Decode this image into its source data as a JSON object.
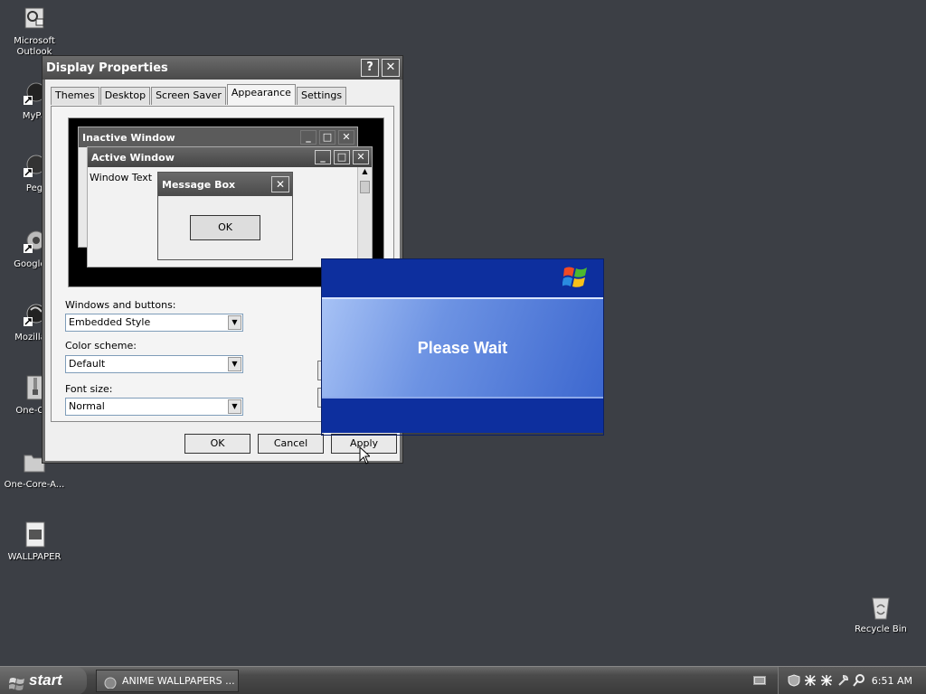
{
  "desktop": {
    "icons": [
      {
        "label": "Microsoft Outlook"
      },
      {
        "label": "MyPa"
      },
      {
        "label": "Peg"
      },
      {
        "label": "Google C"
      },
      {
        "label": "Mozilla F"
      },
      {
        "label": "One-Cor"
      },
      {
        "label": "One-Core-A..."
      },
      {
        "label": "WALLPAPER"
      },
      {
        "label": "Recycle Bin"
      }
    ]
  },
  "dialog": {
    "title": "Display Properties",
    "tabs": [
      "Themes",
      "Desktop",
      "Screen Saver",
      "Appearance",
      "Settings"
    ],
    "active_tab": "Appearance",
    "preview": {
      "inactive_title": "Inactive Window",
      "active_title": "Active Window",
      "window_text": "Window Text",
      "message_title": "Message Box",
      "message_ok": "OK"
    },
    "windows_buttons_label": "Windows and buttons:",
    "windows_buttons_value": "Embedded Style",
    "color_scheme_label": "Color scheme:",
    "color_scheme_value": "Default",
    "font_size_label": "Font size:",
    "font_size_value": "Normal",
    "ok": "OK",
    "cancel": "Cancel",
    "apply": "Apply"
  },
  "wait": {
    "text": "Please Wait"
  },
  "taskbar": {
    "start": "start",
    "task": "ANIME WALLPAPERS ...",
    "clock": "6:51 AM"
  },
  "colors": {
    "desktop_bg": "#3c3f45",
    "wait_blue": "#0d2f9e"
  }
}
